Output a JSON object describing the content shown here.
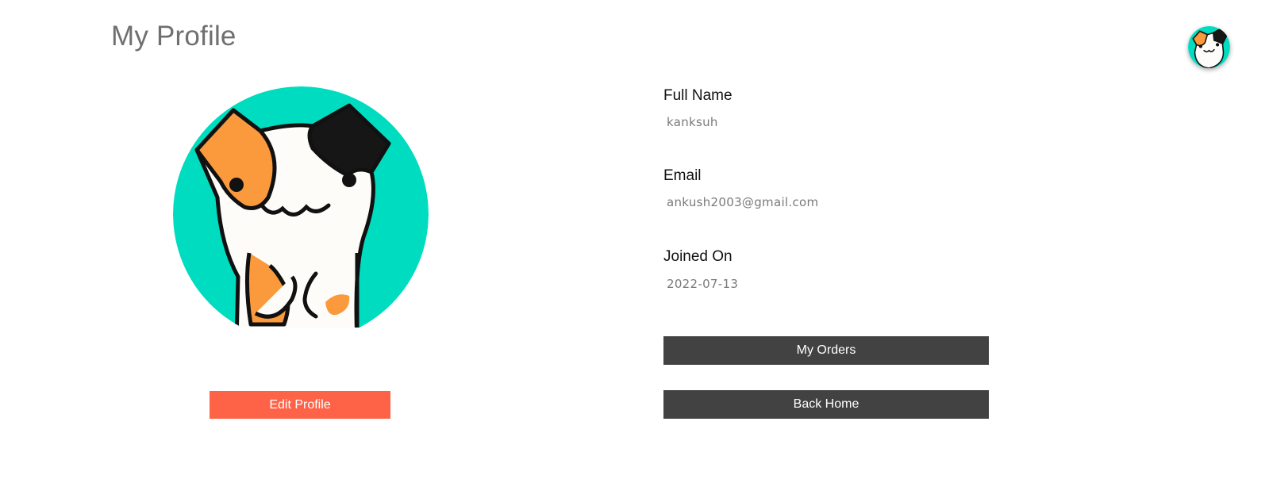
{
  "page": {
    "title": "My Profile"
  },
  "avatar": {
    "icon": "calico-cat-avatar-icon",
    "background_color": "#00dcc0"
  },
  "profile_fields": [
    {
      "label": "Full Name",
      "value": "kanksuh"
    },
    {
      "label": "Email",
      "value": "ankush2003@gmail.com"
    },
    {
      "label": "Joined On",
      "value": "2022-07-13"
    }
  ],
  "actions": {
    "edit_profile_label": "Edit Profile",
    "my_orders_label": "My Orders",
    "back_home_label": "Back Home"
  },
  "colors": {
    "edit_button": "#ff6347",
    "dark_button": "#424242",
    "title_text": "#6f6f6f"
  }
}
